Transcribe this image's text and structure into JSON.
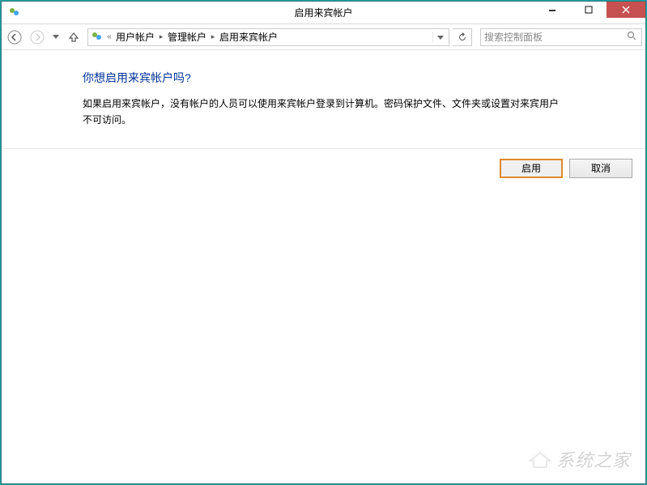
{
  "window": {
    "title": "启用来宾帐户"
  },
  "breadcrumb": {
    "prefix": "«",
    "items": [
      "用户帐户",
      "管理帐户",
      "启用来宾帐户"
    ]
  },
  "search": {
    "placeholder": "搜索控制面板"
  },
  "main": {
    "heading": "你想启用来宾帐户吗?",
    "description": "如果启用来宾帐户，没有帐户的人员可以使用来宾帐户登录到计算机。密码保护文件、文件夹或设置对来宾用户不可访问。"
  },
  "buttons": {
    "enable": "启用",
    "cancel": "取消"
  },
  "watermark": "系统之家"
}
